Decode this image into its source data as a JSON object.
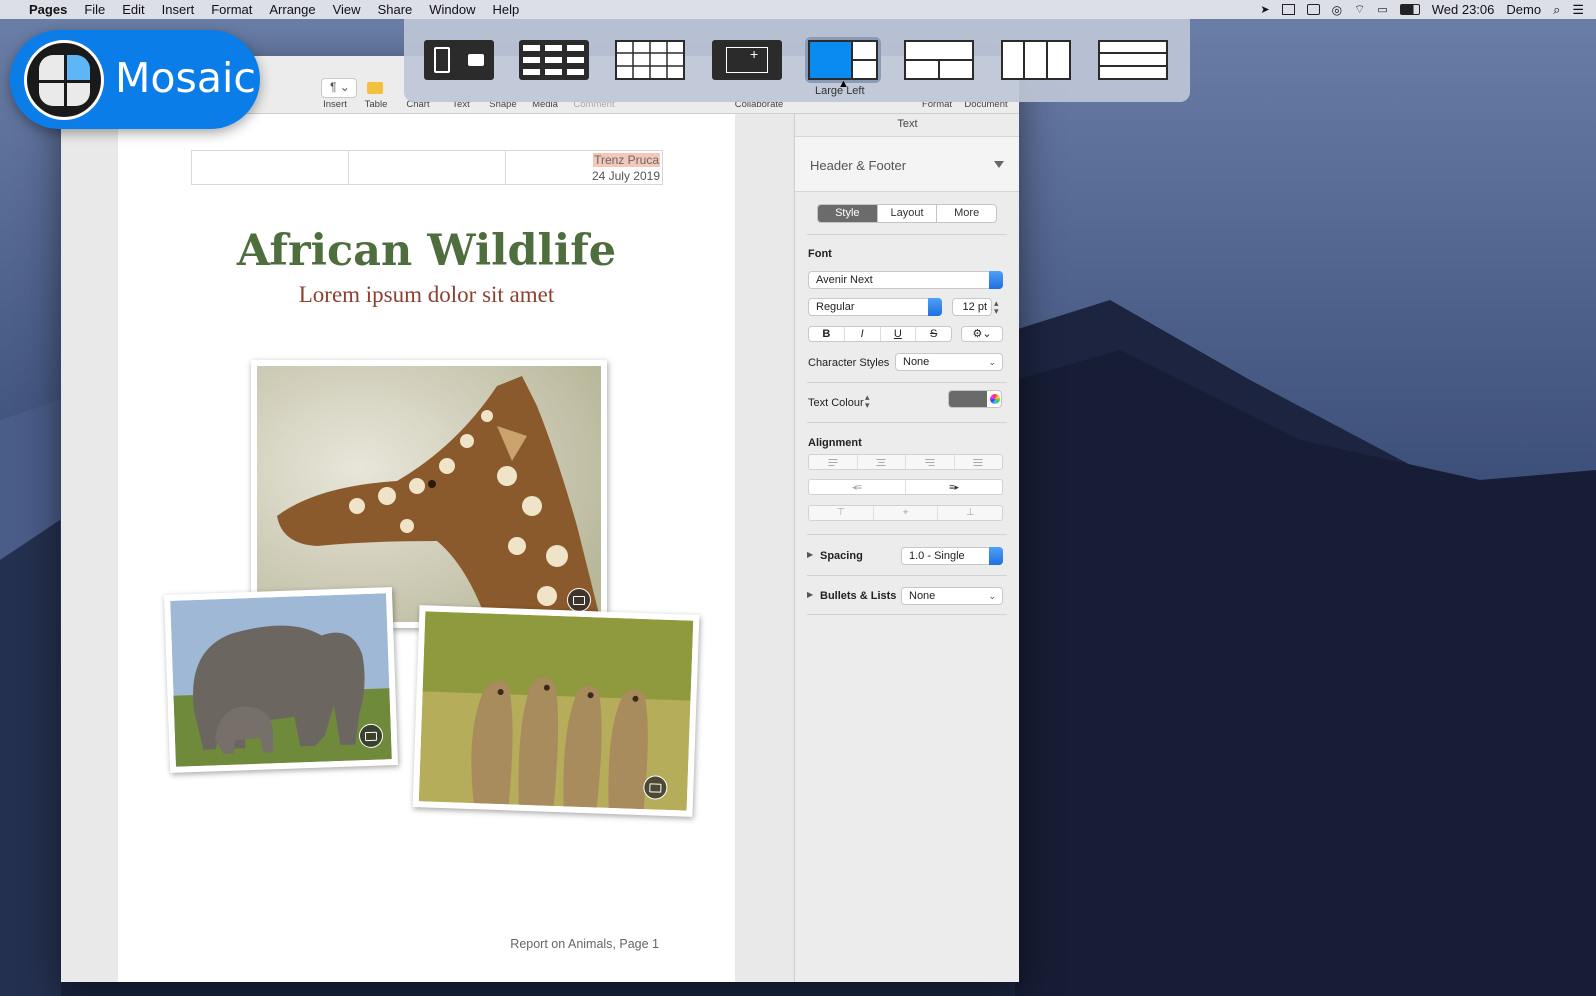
{
  "menubar": {
    "app_name": "Pages",
    "menus": [
      "File",
      "Edit",
      "Insert",
      "Format",
      "Arrange",
      "View",
      "Share",
      "Window",
      "Help"
    ],
    "clock": "Wed 23:06",
    "user": "Demo"
  },
  "mosaic": {
    "badge_label": "Mosaic",
    "layouts": [
      "clipboard-layout",
      "grid-layout-dark",
      "grid-layout-light",
      "resize-layout",
      "large-left-layout",
      "split-horizontal-layout",
      "split-vertical-layout",
      "rows-layout"
    ],
    "hover_tooltip": "Large Left",
    "accent_color": "#0a8bf2"
  },
  "toolbar": {
    "labels": {
      "insert": "Insert",
      "table": "Table",
      "chart": "Chart",
      "text": "Text",
      "shape": "Shape",
      "media": "Media",
      "comment": "Comment",
      "collaborate": "Collaborate",
      "format": "Format",
      "document": "Document"
    }
  },
  "document": {
    "header_author": "Trenz Pruca",
    "header_date": "24 July 2019",
    "title": "African Wildlife",
    "subtitle": "Lorem ipsum dolor sit amet",
    "footer": "Report on Animals, Page 1"
  },
  "inspector": {
    "title": "Text",
    "section": "Header & Footer",
    "tabs": [
      "Style",
      "Layout",
      "More"
    ],
    "font_label": "Font",
    "font_family": "Avenir Next",
    "font_style": "Regular",
    "font_size": "12 pt",
    "format_buttons": [
      "B",
      "I",
      "U",
      "S"
    ],
    "char_styles_label": "Character Styles",
    "char_styles_value": "None",
    "text_colour_label": "Text Colour",
    "alignment_label": "Alignment",
    "spacing_label": "Spacing",
    "spacing_value": "1.0 - Single",
    "bullets_label": "Bullets & Lists",
    "bullets_value": "None"
  }
}
